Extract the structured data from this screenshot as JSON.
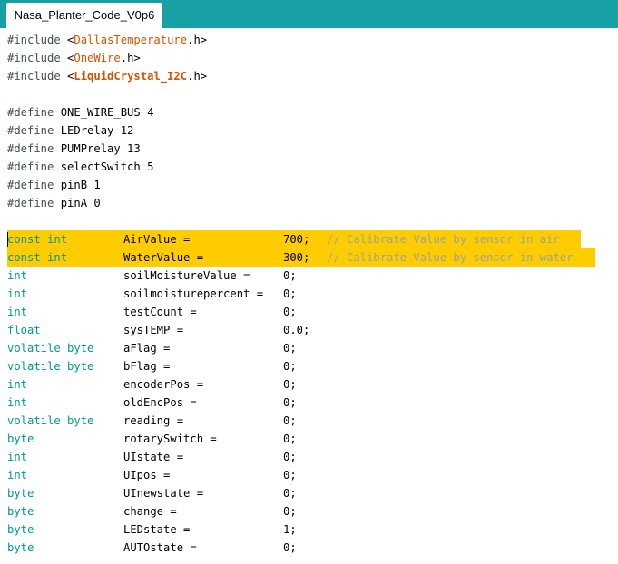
{
  "tab": {
    "label": "Nasa_Planter_Code_V0p6"
  },
  "colors": {
    "tabbar": "#17a1a5",
    "highlight": "#ffcc00",
    "preprocessor": "#434f54",
    "library": "#d35400",
    "type": "#00979c",
    "comment": "#95a5a6",
    "plain": "#000000"
  },
  "lines": [
    {
      "segs": [
        [
          "#include ",
          "preprocessor"
        ],
        [
          "<",
          "plain"
        ],
        [
          "DallasTemperature",
          "library"
        ],
        [
          ".h>",
          "plain"
        ]
      ]
    },
    {
      "segs": [
        [
          "#include ",
          "preprocessor"
        ],
        [
          "<",
          "plain"
        ],
        [
          "OneWire",
          "library"
        ],
        [
          ".h>",
          "plain"
        ]
      ]
    },
    {
      "segs": [
        [
          "#include ",
          "preprocessor"
        ],
        [
          "<",
          "plain"
        ],
        [
          "LiquidCrystal_I2C",
          "library-bold"
        ],
        [
          ".h>",
          "plain"
        ]
      ]
    },
    {
      "segs": []
    },
    {
      "segs": [
        [
          "#define ",
          "preprocessor"
        ],
        [
          "ONE_WIRE_BUS 4",
          "plain"
        ]
      ]
    },
    {
      "segs": [
        [
          "#define ",
          "preprocessor"
        ],
        [
          "LEDrelay 12",
          "plain"
        ]
      ]
    },
    {
      "segs": [
        [
          "#define ",
          "preprocessor"
        ],
        [
          "PUMPrelay 13",
          "plain"
        ]
      ]
    },
    {
      "segs": [
        [
          "#define ",
          "preprocessor"
        ],
        [
          "selectSwitch 5",
          "plain"
        ]
      ]
    },
    {
      "segs": [
        [
          "#define ",
          "preprocessor"
        ],
        [
          "pinB 1",
          "plain"
        ]
      ]
    },
    {
      "segs": [
        [
          "#define ",
          "preprocessor"
        ],
        [
          "pinA 0",
          "plain"
        ]
      ]
    },
    {
      "segs": []
    },
    {
      "highlight": true,
      "cursor": true,
      "type": "const int",
      "name": "AirValue =",
      "value": "700;",
      "comment": "// Calibrate Value by sensor in air"
    },
    {
      "highlight": true,
      "type": "const int",
      "name": "WaterValue =",
      "value": "300;",
      "comment": "// Calibrate Value by sensor in water"
    },
    {
      "type": "int",
      "name": "soilMoistureValue =",
      "value": "0;"
    },
    {
      "type": "int",
      "name": "soilmoisturepercent =",
      "value": "0;"
    },
    {
      "type": "int",
      "name": "testCount =",
      "value": "0;"
    },
    {
      "type": "float",
      "name": "sysTEMP =",
      "value": "0.0;"
    },
    {
      "type": "volatile byte",
      "name": "aFlag =",
      "value": "0;"
    },
    {
      "type": "volatile byte",
      "name": "bFlag =",
      "value": "0;"
    },
    {
      "type": "int",
      "name": "encoderPos =",
      "value": "0;"
    },
    {
      "type": "int",
      "name": "oldEncPos =",
      "value": "0;"
    },
    {
      "type": "volatile byte",
      "name": "reading =",
      "value": "0;"
    },
    {
      "type": "byte",
      "name": "rotarySwitch =",
      "value": "0;"
    },
    {
      "type": "int",
      "name": "UIstate =",
      "value": "0;"
    },
    {
      "type": "int",
      "name": "UIpos =",
      "value": "0;"
    },
    {
      "type": "byte",
      "name": "UInewstate =",
      "value": "0;"
    },
    {
      "type": "byte",
      "name": "change =",
      "value": "0;"
    },
    {
      "type": "byte",
      "name": "LEDstate =",
      "value": "1;"
    },
    {
      "type": "byte",
      "name": "AUTOstate =",
      "value": "0;"
    }
  ]
}
